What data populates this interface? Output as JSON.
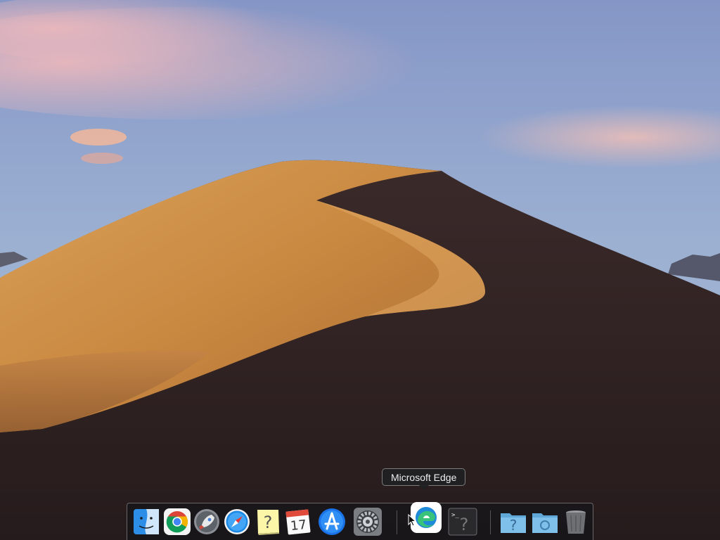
{
  "desktop": {
    "wallpaper_name": "macOS Mojave Day",
    "colors": {
      "sky_top": "#8a9ccb",
      "sky_bottom": "#9bb0d0",
      "cloud_pink": "#e8b4b8",
      "dune_light": "#d69a52",
      "dune_dark": "#2a1e1e"
    }
  },
  "tooltip": {
    "label": "Microsoft Edge"
  },
  "dock": {
    "items": [
      {
        "name": "Finder",
        "icon": "finder-icon"
      },
      {
        "name": "Google Chrome",
        "icon": "chrome-icon"
      },
      {
        "name": "Launchpad",
        "icon": "rocket-icon"
      },
      {
        "name": "Safari",
        "icon": "compass-icon"
      },
      {
        "name": "Unknown App",
        "icon": "question-icon"
      },
      {
        "name": "Calendar",
        "icon": "calendar-icon",
        "date": "17"
      },
      {
        "name": "App Store",
        "icon": "appstore-icon"
      },
      {
        "name": "System Preferences",
        "icon": "gear-icon"
      },
      {
        "name": "Microsoft Edge",
        "icon": "edge-icon"
      },
      {
        "name": "Terminal",
        "icon": "terminal-icon"
      },
      {
        "name": "Folder",
        "icon": "folder-question-icon"
      },
      {
        "name": "Downloads",
        "icon": "downloads-folder-icon"
      },
      {
        "name": "Trash",
        "icon": "trash-icon"
      }
    ]
  }
}
